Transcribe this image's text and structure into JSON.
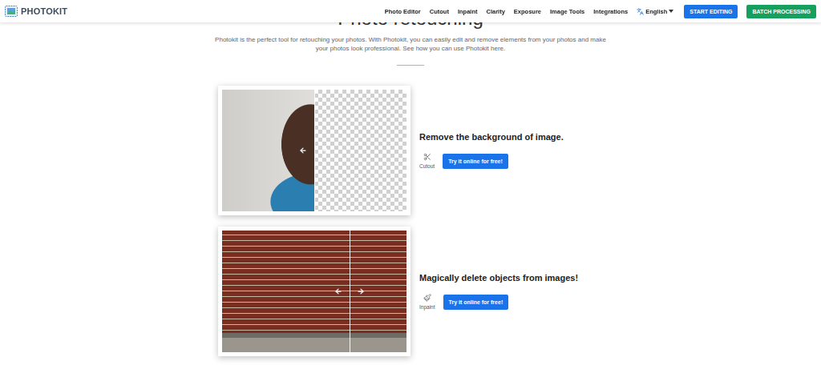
{
  "nav": {
    "logo": "PHOTOKIT",
    "links": [
      {
        "label": "Photo Editor"
      },
      {
        "label": "Cutout"
      },
      {
        "label": "Inpaint"
      },
      {
        "label": "Clarity"
      },
      {
        "label": "Exposure"
      },
      {
        "label": "Image Tools"
      },
      {
        "label": "Integrations"
      }
    ],
    "language": "English",
    "buttons": [
      {
        "label": "START EDITING",
        "color": "#1a73e8"
      },
      {
        "label": "BATCH PROCESSING",
        "color": "#16a05d"
      }
    ]
  },
  "hero": {
    "title": "Photo retouching",
    "description": "Photokit is the perfect tool for retouching your photos. With Photokit, you can easily edit and remove elements from your photos and make your photos look professional. See how you can use Photokit here."
  },
  "features": [
    {
      "kind": "cutout",
      "title": "Remove the background of image.",
      "tool": "Cutout",
      "button": "Try it online for free!"
    },
    {
      "kind": "inpaint",
      "title": "Magically delete objects from images!",
      "tool": "Inpaint",
      "button": "Try it online for free!"
    }
  ]
}
